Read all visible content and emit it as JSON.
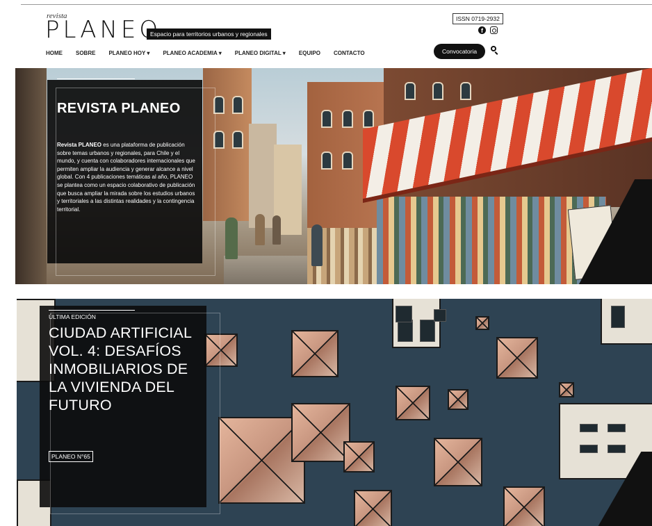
{
  "header": {
    "logo_small": "revista",
    "logo_main": "PLANEO",
    "tagline": "Espacio para territorios urbanos y regionales",
    "issn": "ISSN 0719-2932",
    "cta_label": "Convocatoria"
  },
  "nav": {
    "items": [
      {
        "label": "HOME"
      },
      {
        "label": "SOBRE"
      },
      {
        "label": "PLANEO HOY ▾"
      },
      {
        "label": "PLANEO ACADEMIA ▾"
      },
      {
        "label": "PLANEO DIGITAL ▾"
      },
      {
        "label": "EQUIPO"
      },
      {
        "label": "CONTACTO"
      }
    ]
  },
  "hero1": {
    "title": "REVISTA PLANEO",
    "body_bold": "Revista PLANEO",
    "body_rest": " es una plataforma de publicación sobre temas urbanos y regionales, para Chile y el mundo, y cuenta con colaboradores internacionales que permiten ampliar la audiencia y generar alcance a nivel global. Con 4 publicaciones temáticas al año, PLANEO se plantea como un espacio colaborativo de publicación que busca ampliar la mirada sobre los estudios urbanos y territoriales a las distintas realidades y la contingencia territorial.",
    "next_arrow": "›"
  },
  "hero2": {
    "label": "ÚLTIMA EDICIÓN",
    "title": "CIUDAD ARTIFICIAL VOL. 4: DESAFÍOS INMOBILIARIOS DE LA VIVIENDA DEL FUTURO",
    "badge": "PLANEO N°65"
  },
  "icons": [
    "facebook-icon",
    "instagram-icon",
    "search-icon",
    "chevron-right-icon"
  ],
  "colors": {
    "accent": "#111111",
    "background": "#ffffff"
  }
}
